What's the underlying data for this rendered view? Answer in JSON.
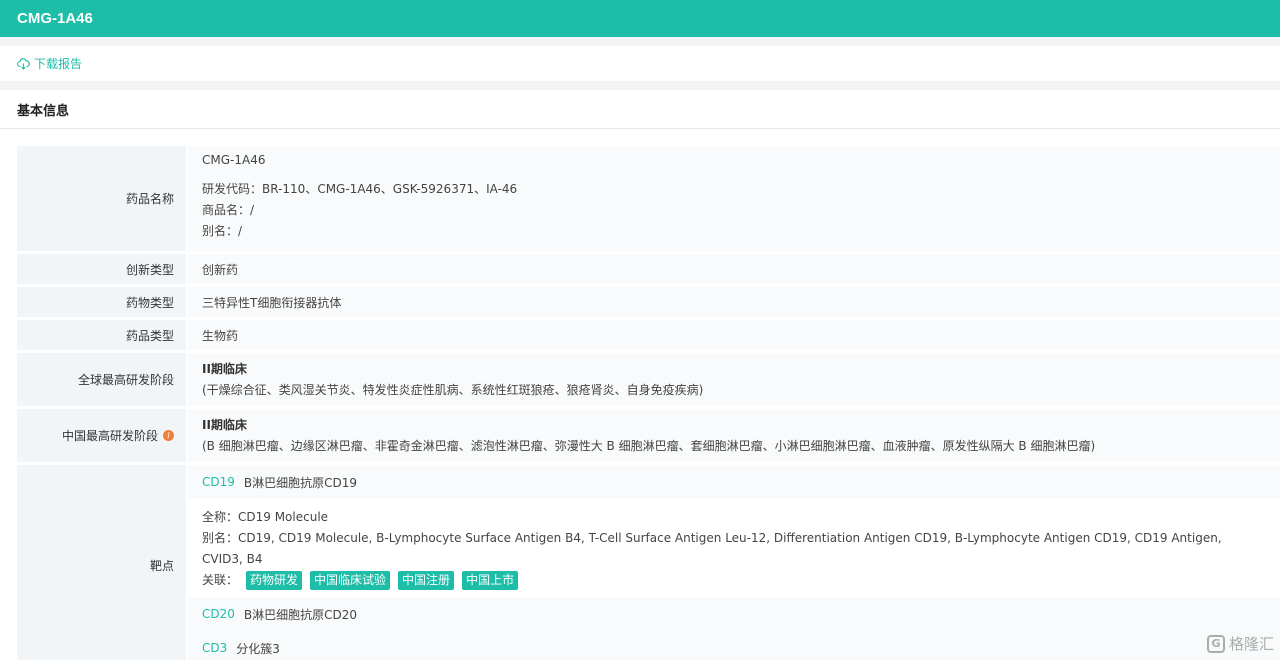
{
  "header": {
    "title": "CMG-1A46"
  },
  "download": {
    "label": "下载报告",
    "icon": "cloud-download-icon"
  },
  "section": {
    "title": "基本信息"
  },
  "fields": {
    "drug_name": {
      "label": "药品名称",
      "primary": "CMG-1A46",
      "dev_code": "研发代码：BR-110、CMG-1A46、GSK-5926371、IA-46",
      "trade_name": "商品名：/",
      "alias": "别名：/"
    },
    "innovation_type": {
      "label": "创新类型",
      "value": "创新药"
    },
    "drug_type": {
      "label": "药物类型",
      "value": "三特异性T细胞衔接器抗体"
    },
    "product_type": {
      "label": "药品类型",
      "value": "生物药"
    },
    "global_stage": {
      "label": "全球最高研发阶段",
      "stage": "II期临床",
      "indications": "(干燥综合征、类风湿关节炎、特发性炎症性肌病、系统性红斑狼疮、狼疮肾炎、自身免疫疾病)"
    },
    "china_stage": {
      "label": "中国最高研发阶段",
      "stage": "II期临床",
      "indications": "(B 细胞淋巴瘤、边缘区淋巴瘤、非霍奇金淋巴瘤、滤泡性淋巴瘤、弥漫性大 B 细胞淋巴瘤、套细胞淋巴瘤、小淋巴细胞淋巴瘤、血液肿瘤、原发性纵隔大 B 细胞淋巴瘤)"
    },
    "target": {
      "label": "靶点",
      "items": [
        {
          "code": "CD19",
          "name": "B淋巴细胞抗原CD19",
          "full_name": "全称：CD19 Molecule",
          "aliases": "别名：CD19, CD19 Molecule, B-Lymphocyte Surface Antigen B4, T-Cell Surface Antigen Leu-12, Differentiation Antigen CD19, B-Lymphocyte Antigen CD19, CD19 Antigen, CVID3, B4",
          "related_label": "关联：",
          "tags": [
            "药物研发",
            "中国临床试验",
            "中国注册",
            "中国上市"
          ]
        },
        {
          "code": "CD20",
          "name": "B淋巴细胞抗原CD20"
        },
        {
          "code": "CD3",
          "name": "分化簇3"
        }
      ]
    }
  },
  "watermark": {
    "logo": "G",
    "text": "格隆汇"
  },
  "colors": {
    "accent": "#1ebda8",
    "info": "#f07f3c"
  }
}
